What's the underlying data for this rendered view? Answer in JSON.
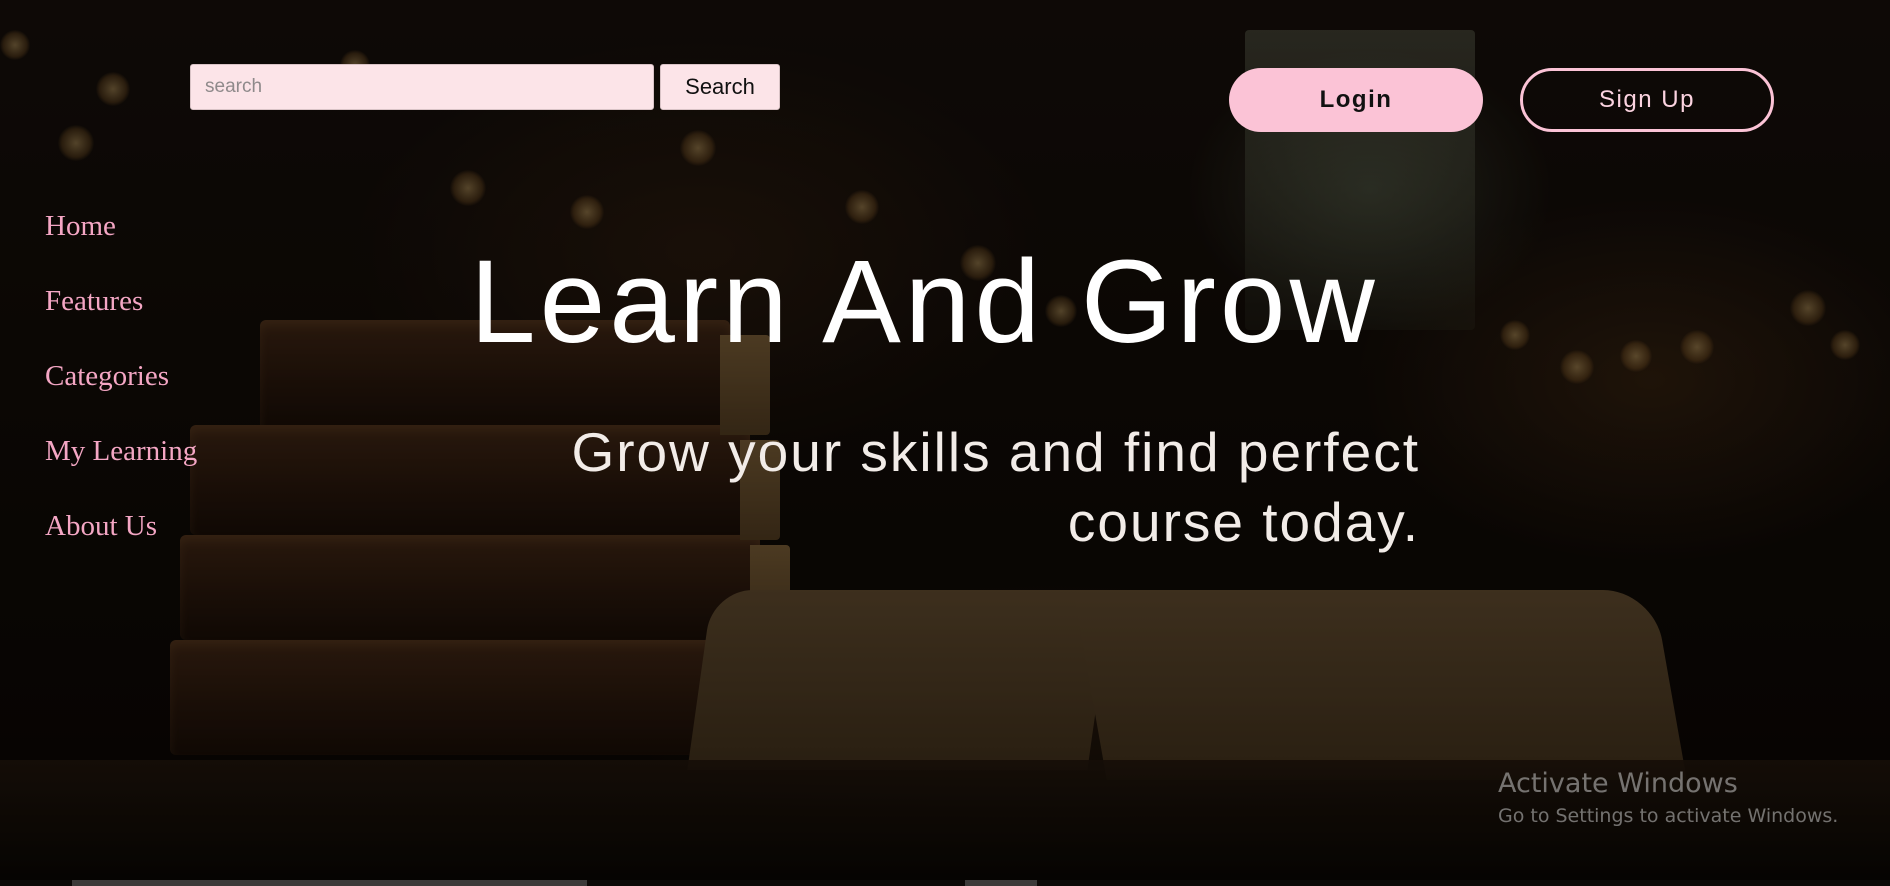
{
  "header": {
    "search": {
      "placeholder": "search",
      "value": "",
      "button_label": "Search"
    },
    "login_label": "Login",
    "signup_label": "Sign Up"
  },
  "nav": {
    "items": [
      {
        "label": "Home"
      },
      {
        "label": "Features"
      },
      {
        "label": "Categories"
      },
      {
        "label": "My Learning"
      },
      {
        "label": "About Us"
      }
    ]
  },
  "hero": {
    "title": "Learn And Grow",
    "subtitle": "Grow your skills and find perfect course today."
  },
  "watermark": {
    "title": "Activate Windows",
    "subtitle": "Go to Settings to activate Windows."
  },
  "colors": {
    "accent_pink": "#fbc3d6",
    "nav_link_pink": "#f4a6c4",
    "search_bg": "#fce4e8",
    "hero_text": "#ffffff"
  },
  "icons": {
    "background": "library-books-photo"
  }
}
